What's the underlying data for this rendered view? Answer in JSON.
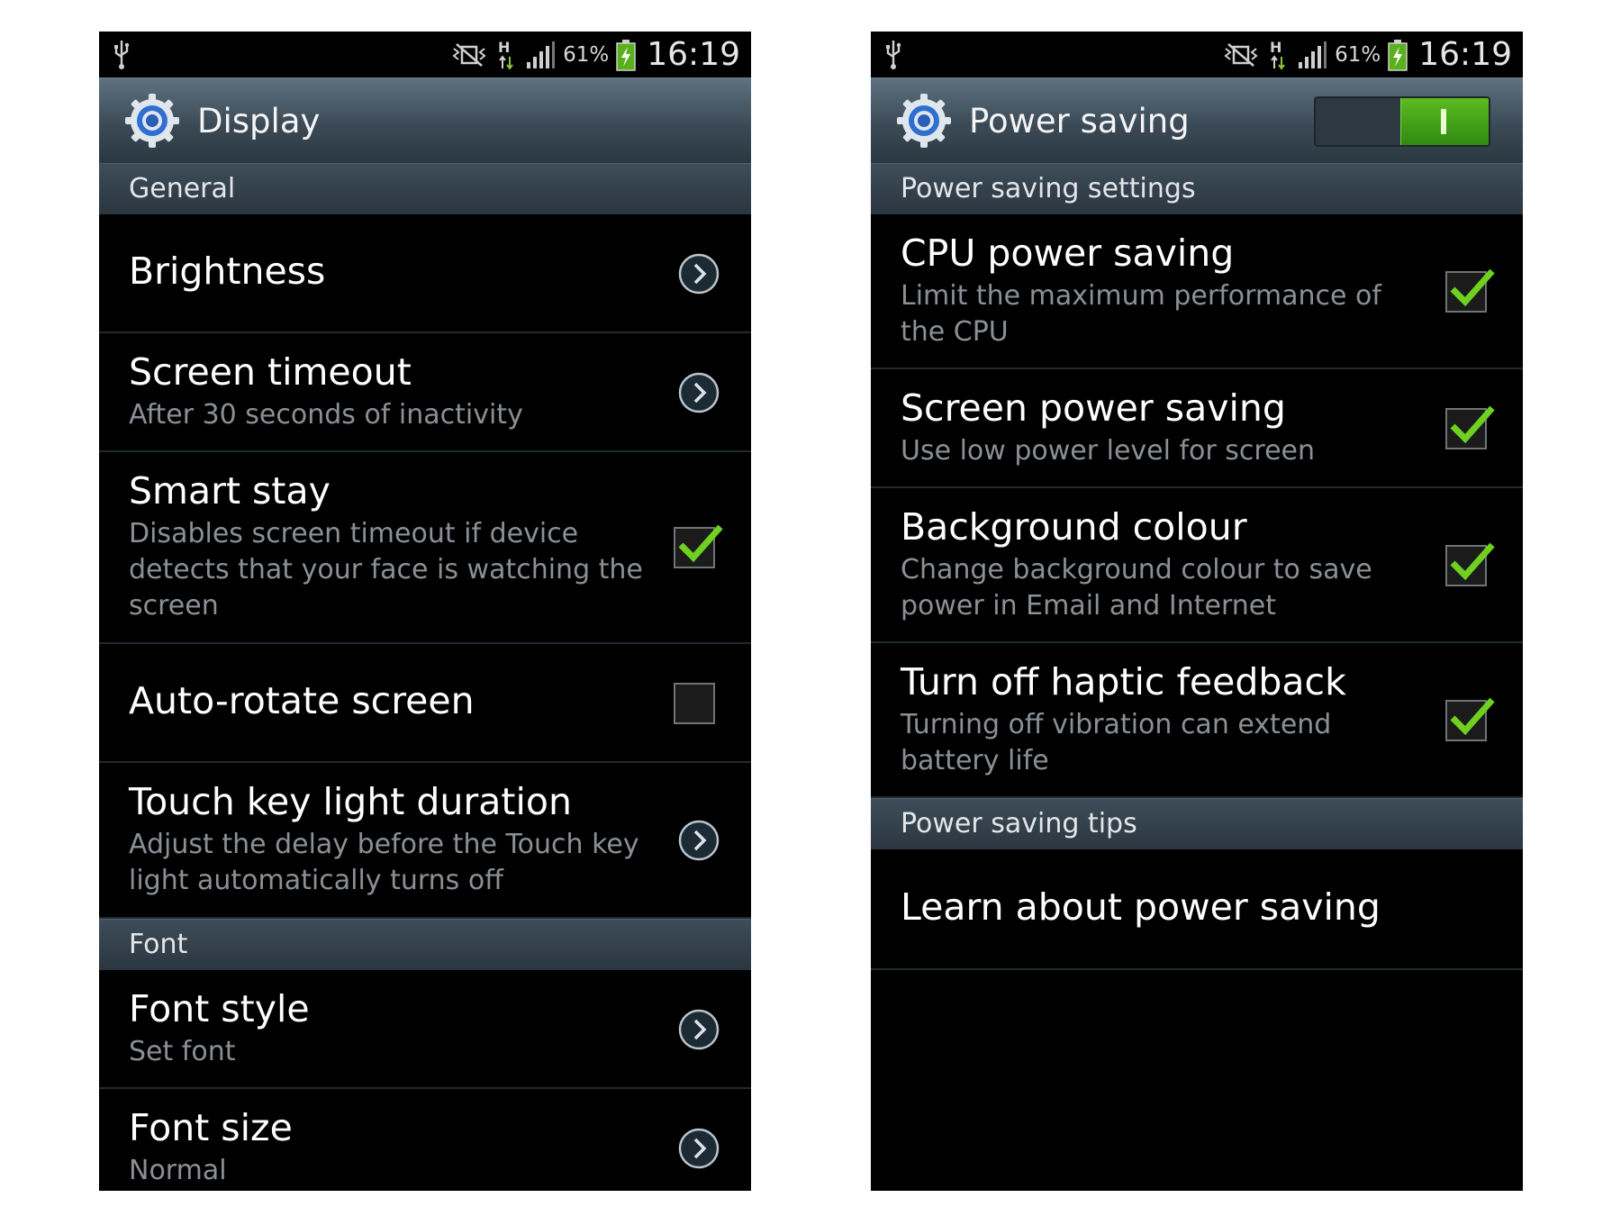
{
  "status_bar": {
    "usb_icon": "usb-icon",
    "mute_icon": "vibrate-mute-icon",
    "network_label": "H",
    "battery_percent": "61%",
    "time": "16:19"
  },
  "left": {
    "title": "Display",
    "sections": {
      "general": "General",
      "font": "Font"
    },
    "items": {
      "brightness": {
        "title": "Brightness"
      },
      "screen_timeout": {
        "title": "Screen timeout",
        "subtitle": "After 30 seconds of inactivity"
      },
      "smart_stay": {
        "title": "Smart stay",
        "subtitle": "Disables screen timeout if device\ndetects that your face is watching the\nscreen",
        "checked": true
      },
      "auto_rotate": {
        "title": "Auto-rotate screen",
        "checked": false
      },
      "touch_key": {
        "title": "Touch key light duration",
        "subtitle": "Adjust the delay before the Touch key\nlight automatically turns off"
      },
      "font_style": {
        "title": "Font style",
        "subtitle": "Set font"
      },
      "font_size": {
        "title": "Font size",
        "subtitle": "Normal"
      }
    }
  },
  "right": {
    "title": "Power saving",
    "toggle_on": true,
    "toggle_label": "I",
    "sections": {
      "settings": "Power saving settings",
      "tips": "Power saving tips"
    },
    "items": {
      "cpu": {
        "title": "CPU power saving",
        "subtitle": "Limit the maximum performance of\nthe CPU",
        "checked": true
      },
      "screen": {
        "title": "Screen power saving",
        "subtitle": "Use low power level for screen",
        "checked": true
      },
      "background": {
        "title": "Background colour",
        "subtitle": "Change background colour to save\npower in Email and Internet",
        "checked": true
      },
      "haptic": {
        "title": "Turn off haptic feedback",
        "subtitle": "Turning off vibration can extend\nbattery life",
        "checked": true
      },
      "learn": {
        "title": "Learn about power saving"
      }
    }
  },
  "colors": {
    "accent_green": "#6fd020",
    "header_blue_gray": "#3b4a56",
    "secondary_text": "#8a9096"
  }
}
